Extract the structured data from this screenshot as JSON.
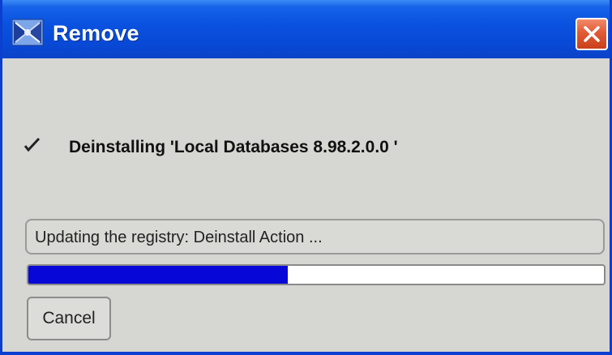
{
  "window": {
    "title": "Remove",
    "title_icon": "installer-icon",
    "close_icon": "close-icon",
    "colors": {
      "titlebar": "#0849d6",
      "body": "#d6d6d2",
      "close_button": "#e25a36"
    }
  },
  "status": {
    "icon": "check-icon",
    "heading": "Deinstalling 'Local Databases 8.98.2.0.0 '"
  },
  "message": {
    "text": "Updating the registry: Deinstall Action ..."
  },
  "progress": {
    "fraction": 0.45,
    "fill_color": "#0707d8"
  },
  "buttons": {
    "cancel_label": "Cancel"
  }
}
